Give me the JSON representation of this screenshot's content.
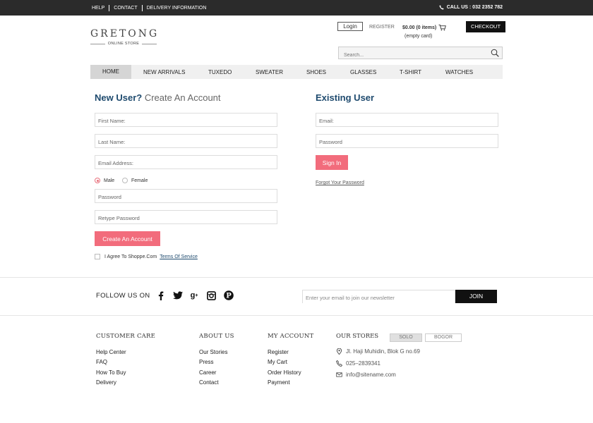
{
  "topbar": {
    "links": [
      "HELP",
      "CONTACT",
      "DELIVERY INFORMATION"
    ],
    "call_us": "CALL US : 032 2352 782"
  },
  "header": {
    "logo_name": "GRETONG",
    "logo_sub": "ONLINE STORE",
    "login": "Login",
    "register": "REGISTER",
    "cart_summary": "$0.00 (0 items)",
    "cart_empty": "(empty card)",
    "checkout": "CHECKOUT",
    "search_placeholder": "Search..."
  },
  "nav": {
    "items": [
      "HOME",
      "NEW ARRIVALS",
      "TUXEDO",
      "SWEATER",
      "SHOES",
      "GLASSES",
      "T-SHIRT",
      "WATCHES"
    ],
    "active": "HOME"
  },
  "register_form": {
    "title_bold": "New User?",
    "title_light": "Create An Account",
    "first_name": "First Name:",
    "last_name": "Last Name:",
    "email": "Email Address:",
    "gender_male": "Male",
    "gender_female": "Female",
    "gender_selected": "Male",
    "password": "Password",
    "retype_password": "Retype Password",
    "submit": "Create An Account",
    "agree_text": "I Agree To Shoppe.Com",
    "tos": "Terms Of Service"
  },
  "login_form": {
    "title": "Existing User",
    "email": "Email:",
    "password": "Password",
    "submit": "Sign In",
    "forgot": "Forgot Your Password"
  },
  "follow": {
    "label": "FOLLOW US ON",
    "social_icons": [
      "facebook-icon",
      "twitter-icon",
      "google-plus-icon",
      "instagram-icon",
      "pinterest-icon"
    ],
    "newsletter_placeholder": "Enter your email to join our newsletter",
    "join": "JOIN"
  },
  "footer": {
    "customer_care": {
      "title": "CUSTOMER CARE",
      "items": [
        "Help Center",
        "FAQ",
        "How To Buy",
        "Delivery"
      ]
    },
    "about_us": {
      "title": "ABOUT US",
      "items": [
        "Our Stories",
        "Press",
        "Career",
        "Contact"
      ]
    },
    "my_account": {
      "title": "MY ACCOUNT",
      "items": [
        "Register",
        "My Cart",
        "Order History",
        "Payment"
      ]
    },
    "stores": {
      "title": "OUR STORES",
      "tabs": [
        "SOLO",
        "BOGOR"
      ],
      "active_tab": "SOLO",
      "address": "Jl. Haji Muhidin, Blok G no.69",
      "phone": "025–2839341",
      "email": "info@sitename.com"
    }
  },
  "colors": {
    "accent": "#f26c7c",
    "heading": "#1e4a6e",
    "topbar": "#2b2b2b"
  }
}
